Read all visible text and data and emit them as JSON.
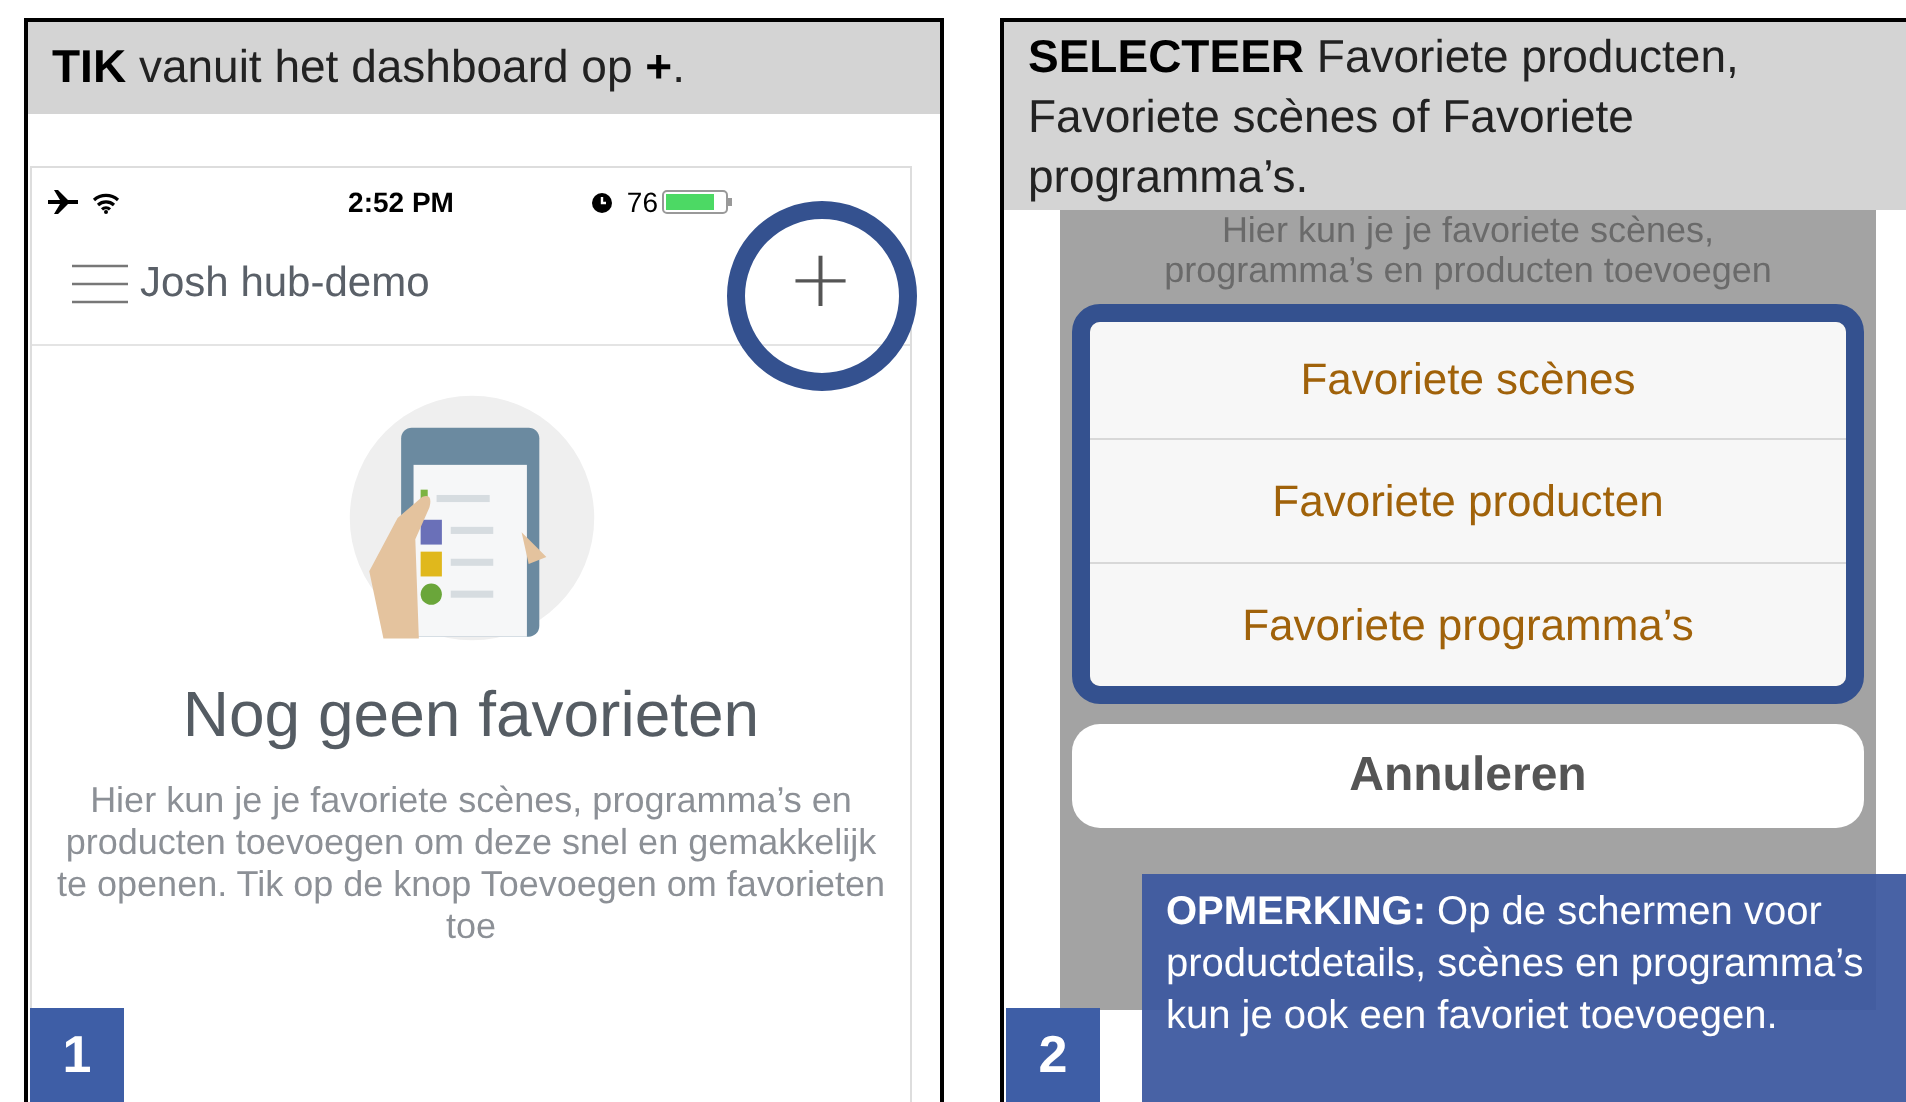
{
  "step_1": {
    "number": "1",
    "instruction": "**TIK** vanuit het dashboard op **+**.",
    "screen": {
      "status_bar": {
        "time": "2:52 PM",
        "battery": "76"
      },
      "nav": {
        "title": "Josh hub-demo",
        "add_button": "+",
        "highlighted": true
      },
      "empty_state": {
        "title": "Nog geen favorieten",
        "message": "Hier kun je je favoriete scènes, programma’s en producten toevoegen om deze snel en gemakkelijk te openen. Tik op de knop Toevoegen om favorieten toe"
      }
    }
  },
  "step_2": {
    "number": "2",
    "instruction": "**SELECTEER** Favoriete producten, Favoriete scènes of Favoriete programma’s.",
    "screen": {
      "background_text": [
        "Hier kun je je favoriete scènes,",
        "programma’s en producten toevoegen"
      ],
      "options": [
        "Favoriete scènes",
        "Favoriete producten",
        "Favoriete programma’s"
      ],
      "highlighted": true,
      "cancel": "Annuleren"
    },
    "note": "**OPMERKING:** Op de schermen voor productdetails, scènes en programma’s kun je ook een favoriet toevoegen."
  }
}
